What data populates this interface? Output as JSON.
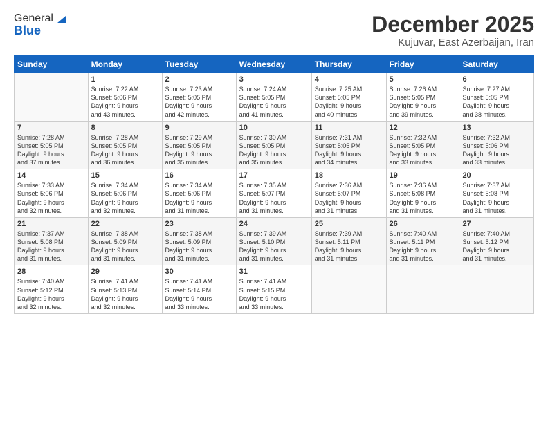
{
  "header": {
    "logo_general": "General",
    "logo_blue": "Blue",
    "month_title": "December 2025",
    "location": "Kujuvar, East Azerbaijan, Iran"
  },
  "days_of_week": [
    "Sunday",
    "Monday",
    "Tuesday",
    "Wednesday",
    "Thursday",
    "Friday",
    "Saturday"
  ],
  "weeks": [
    [
      {
        "day": "",
        "info": ""
      },
      {
        "day": "1",
        "info": "Sunrise: 7:22 AM\nSunset: 5:06 PM\nDaylight: 9 hours\nand 43 minutes."
      },
      {
        "day": "2",
        "info": "Sunrise: 7:23 AM\nSunset: 5:05 PM\nDaylight: 9 hours\nand 42 minutes."
      },
      {
        "day": "3",
        "info": "Sunrise: 7:24 AM\nSunset: 5:05 PM\nDaylight: 9 hours\nand 41 minutes."
      },
      {
        "day": "4",
        "info": "Sunrise: 7:25 AM\nSunset: 5:05 PM\nDaylight: 9 hours\nand 40 minutes."
      },
      {
        "day": "5",
        "info": "Sunrise: 7:26 AM\nSunset: 5:05 PM\nDaylight: 9 hours\nand 39 minutes."
      },
      {
        "day": "6",
        "info": "Sunrise: 7:27 AM\nSunset: 5:05 PM\nDaylight: 9 hours\nand 38 minutes."
      }
    ],
    [
      {
        "day": "7",
        "info": "Sunrise: 7:28 AM\nSunset: 5:05 PM\nDaylight: 9 hours\nand 37 minutes."
      },
      {
        "day": "8",
        "info": "Sunrise: 7:28 AM\nSunset: 5:05 PM\nDaylight: 9 hours\nand 36 minutes."
      },
      {
        "day": "9",
        "info": "Sunrise: 7:29 AM\nSunset: 5:05 PM\nDaylight: 9 hours\nand 35 minutes."
      },
      {
        "day": "10",
        "info": "Sunrise: 7:30 AM\nSunset: 5:05 PM\nDaylight: 9 hours\nand 35 minutes."
      },
      {
        "day": "11",
        "info": "Sunrise: 7:31 AM\nSunset: 5:05 PM\nDaylight: 9 hours\nand 34 minutes."
      },
      {
        "day": "12",
        "info": "Sunrise: 7:32 AM\nSunset: 5:05 PM\nDaylight: 9 hours\nand 33 minutes."
      },
      {
        "day": "13",
        "info": "Sunrise: 7:32 AM\nSunset: 5:06 PM\nDaylight: 9 hours\nand 33 minutes."
      }
    ],
    [
      {
        "day": "14",
        "info": "Sunrise: 7:33 AM\nSunset: 5:06 PM\nDaylight: 9 hours\nand 32 minutes."
      },
      {
        "day": "15",
        "info": "Sunrise: 7:34 AM\nSunset: 5:06 PM\nDaylight: 9 hours\nand 32 minutes."
      },
      {
        "day": "16",
        "info": "Sunrise: 7:34 AM\nSunset: 5:06 PM\nDaylight: 9 hours\nand 31 minutes."
      },
      {
        "day": "17",
        "info": "Sunrise: 7:35 AM\nSunset: 5:07 PM\nDaylight: 9 hours\nand 31 minutes."
      },
      {
        "day": "18",
        "info": "Sunrise: 7:36 AM\nSunset: 5:07 PM\nDaylight: 9 hours\nand 31 minutes."
      },
      {
        "day": "19",
        "info": "Sunrise: 7:36 AM\nSunset: 5:08 PM\nDaylight: 9 hours\nand 31 minutes."
      },
      {
        "day": "20",
        "info": "Sunrise: 7:37 AM\nSunset: 5:08 PM\nDaylight: 9 hours\nand 31 minutes."
      }
    ],
    [
      {
        "day": "21",
        "info": "Sunrise: 7:37 AM\nSunset: 5:08 PM\nDaylight: 9 hours\nand 31 minutes."
      },
      {
        "day": "22",
        "info": "Sunrise: 7:38 AM\nSunset: 5:09 PM\nDaylight: 9 hours\nand 31 minutes."
      },
      {
        "day": "23",
        "info": "Sunrise: 7:38 AM\nSunset: 5:09 PM\nDaylight: 9 hours\nand 31 minutes."
      },
      {
        "day": "24",
        "info": "Sunrise: 7:39 AM\nSunset: 5:10 PM\nDaylight: 9 hours\nand 31 minutes."
      },
      {
        "day": "25",
        "info": "Sunrise: 7:39 AM\nSunset: 5:11 PM\nDaylight: 9 hours\nand 31 minutes."
      },
      {
        "day": "26",
        "info": "Sunrise: 7:40 AM\nSunset: 5:11 PM\nDaylight: 9 hours\nand 31 minutes."
      },
      {
        "day": "27",
        "info": "Sunrise: 7:40 AM\nSunset: 5:12 PM\nDaylight: 9 hours\nand 31 minutes."
      }
    ],
    [
      {
        "day": "28",
        "info": "Sunrise: 7:40 AM\nSunset: 5:12 PM\nDaylight: 9 hours\nand 32 minutes."
      },
      {
        "day": "29",
        "info": "Sunrise: 7:41 AM\nSunset: 5:13 PM\nDaylight: 9 hours\nand 32 minutes."
      },
      {
        "day": "30",
        "info": "Sunrise: 7:41 AM\nSunset: 5:14 PM\nDaylight: 9 hours\nand 33 minutes."
      },
      {
        "day": "31",
        "info": "Sunrise: 7:41 AM\nSunset: 5:15 PM\nDaylight: 9 hours\nand 33 minutes."
      },
      {
        "day": "",
        "info": ""
      },
      {
        "day": "",
        "info": ""
      },
      {
        "day": "",
        "info": ""
      }
    ]
  ]
}
